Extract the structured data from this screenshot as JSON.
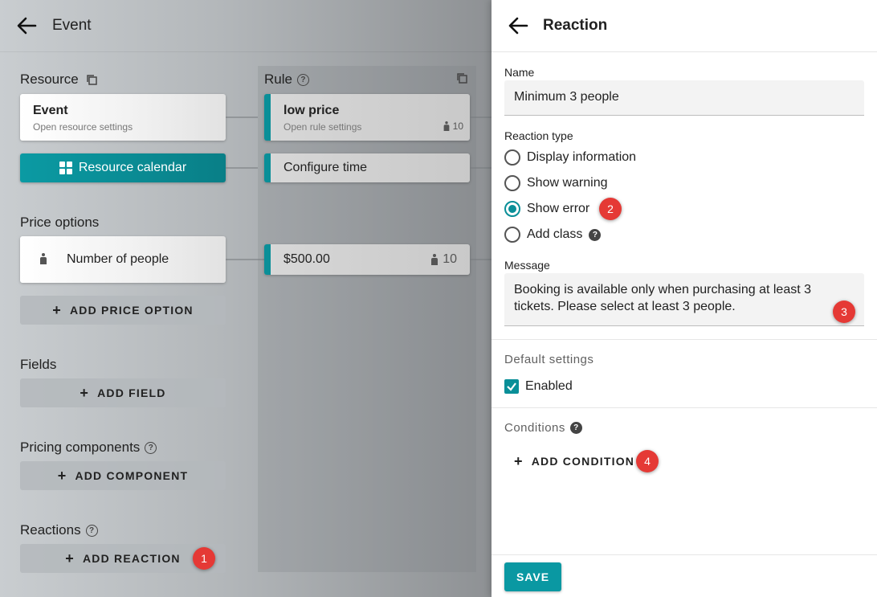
{
  "left": {
    "title": "Event",
    "resource": {
      "label": "Resource",
      "card_title": "Event",
      "card_sub": "Open resource settings",
      "calendar_label": "Resource calendar"
    },
    "rule": {
      "label": "Rule",
      "card_title": "low price",
      "card_sub": "Open rule settings",
      "card_count": "10",
      "time_label": "Configure time",
      "price_value": "$500.00",
      "price_count": "10"
    },
    "price_options": {
      "label": "Price options",
      "item": "Number of people",
      "add_label": "ADD PRICE OPTION"
    },
    "fields": {
      "label": "Fields",
      "add_label": "ADD FIELD"
    },
    "pricing_components": {
      "label": "Pricing components",
      "add_label": "ADD COMPONENT"
    },
    "reactions": {
      "label": "Reactions",
      "add_label": "ADD REACTION"
    }
  },
  "right": {
    "title": "Reaction",
    "name_label": "Name",
    "name_value": "Minimum 3 people",
    "reaction_type_label": "Reaction type",
    "reaction_options": [
      "Display information",
      "Show warning",
      "Show error",
      "Add class"
    ],
    "selected_option": "Show error",
    "message_label": "Message",
    "message_value": "Booking is available only when purchasing at least 3 tickets. Please select at least 3 people.",
    "default_settings_label": "Default settings",
    "enabled_label": "Enabled",
    "enabled_checked": true,
    "conditions_label": "Conditions",
    "add_condition_label": "ADD CONDITION",
    "save_label": "SAVE"
  },
  "badges": [
    "1",
    "2",
    "3",
    "4"
  ],
  "colors": {
    "accent": "#0a8f98",
    "badge": "#e53935"
  }
}
